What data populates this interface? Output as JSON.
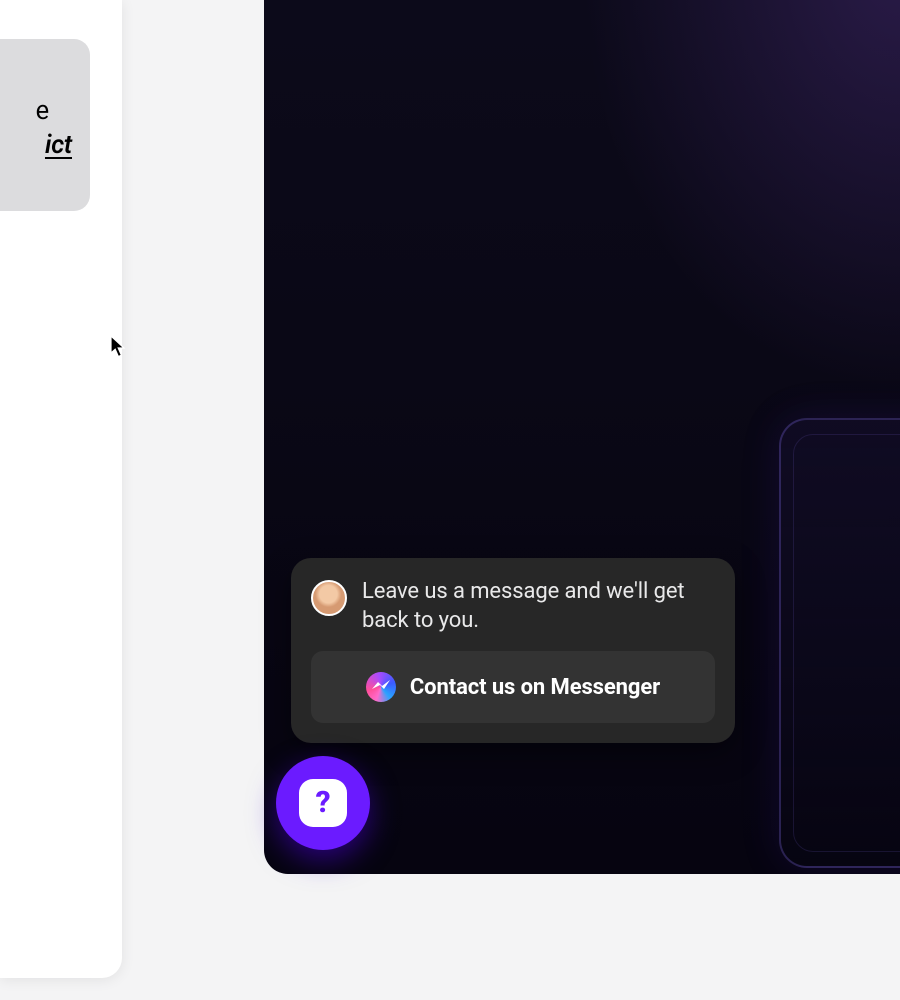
{
  "left_card": {
    "fragment_line1": "e",
    "fragment_line2": "ict"
  },
  "chat": {
    "prompt": "Leave us a message and we'll get back to you.",
    "cta_label": "Contact us on Messenger"
  },
  "fab": {
    "glyph": "?"
  },
  "colors": {
    "accent_purple": "#6b1bff",
    "card_bg": "#272727",
    "cta_bg": "#333333"
  }
}
